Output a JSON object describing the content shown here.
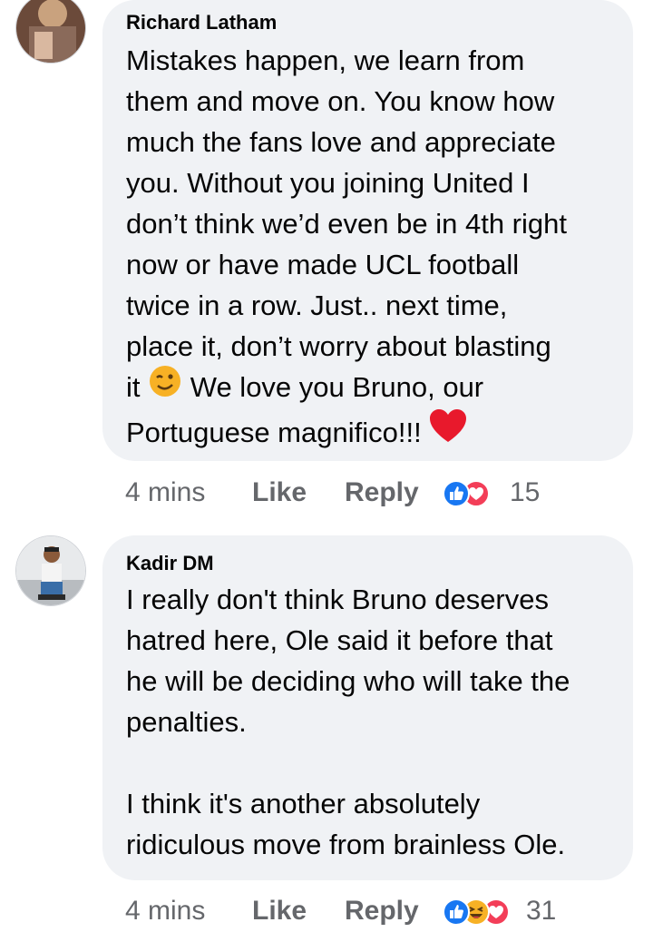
{
  "comments": [
    {
      "author": "Richard Latham",
      "text_lines": [
        "Mistakes happen, we learn from",
        "them and move on. You know how",
        "much the fans love and appreciate",
        "you. Without you joining United I",
        "don’t think we’d even be in 4th right",
        "now or have made UCL football",
        "twice in a row. Just.. next time,",
        "place it, don’t worry about blasting"
      ],
      "line9_before": "it",
      "line9_after": "We love you Bruno, our",
      "line10": "Portuguese magnifico!!!",
      "inline_emojis": [
        "winking-face",
        "red-heart"
      ],
      "time": "4 mins",
      "like_label": "Like",
      "reply_label": "Reply",
      "reactions": [
        "like",
        "love"
      ],
      "reaction_count": "15"
    },
    {
      "author": "Kadir DM",
      "text_lines": [
        "I really don't think Bruno deserves",
        "hatred here, Ole said it before that",
        "he will be deciding who will take the",
        "penalties.",
        "",
        "I think it's another absolutely",
        "ridiculous move from brainless Ole."
      ],
      "time": "4 mins",
      "like_label": "Like",
      "reply_label": "Reply",
      "reactions": [
        "like",
        "haha",
        "love"
      ],
      "reaction_count": "31"
    }
  ],
  "colors": {
    "bubble": "#f0f2f5",
    "meta_text": "#65676b",
    "like_blue": "#1877f2",
    "love_red": "#f33e58",
    "haha_yellow": "#f7b125"
  }
}
